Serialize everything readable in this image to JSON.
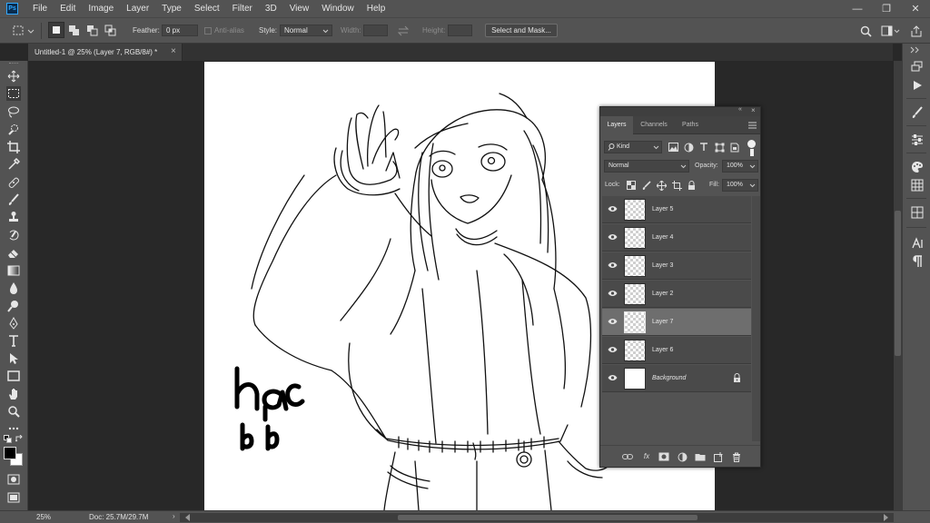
{
  "app": {
    "logo_text": "Ps"
  },
  "menu": [
    "File",
    "Edit",
    "Image",
    "Layer",
    "Type",
    "Select",
    "Filter",
    "3D",
    "View",
    "Window",
    "Help"
  ],
  "window_controls": {
    "minimize": "—",
    "restore": "❐",
    "close": "✕"
  },
  "options": {
    "feather_label": "Feather:",
    "feather_value": "0 px",
    "antialias_label": "Anti-alias",
    "style_label": "Style:",
    "style_value": "Normal",
    "width_label": "Width:",
    "height_label": "Height:",
    "select_mask_label": "Select and Mask..."
  },
  "document_tab": {
    "title": "Untitled-1 @ 25% (Layer 7, RGB/8#) *",
    "close": "×"
  },
  "colors": {
    "foreground": "#000000",
    "background": "#ffffff",
    "accent": "#31a8ff"
  },
  "status": {
    "zoom": "25%",
    "doc_info": "Doc: 25.7M/29.7M"
  },
  "layers_panel": {
    "tabs": [
      "Layers",
      "Channels",
      "Paths"
    ],
    "active_tab": "Layers",
    "filter_label": "Kind",
    "blend_mode": "Normal",
    "opacity_label": "Opacity:",
    "opacity_value": "100%",
    "lock_label": "Lock:",
    "fill_label": "Fill:",
    "fill_value": "100%",
    "layers": [
      {
        "name": "Layer 5",
        "selected": false
      },
      {
        "name": "Layer 4",
        "selected": false
      },
      {
        "name": "Layer 3",
        "selected": false
      },
      {
        "name": "Layer 2",
        "selected": false
      },
      {
        "name": "Layer 7",
        "selected": true
      },
      {
        "name": "Layer 6",
        "selected": false
      },
      {
        "name": "Background",
        "selected": false,
        "locked": true
      }
    ]
  }
}
